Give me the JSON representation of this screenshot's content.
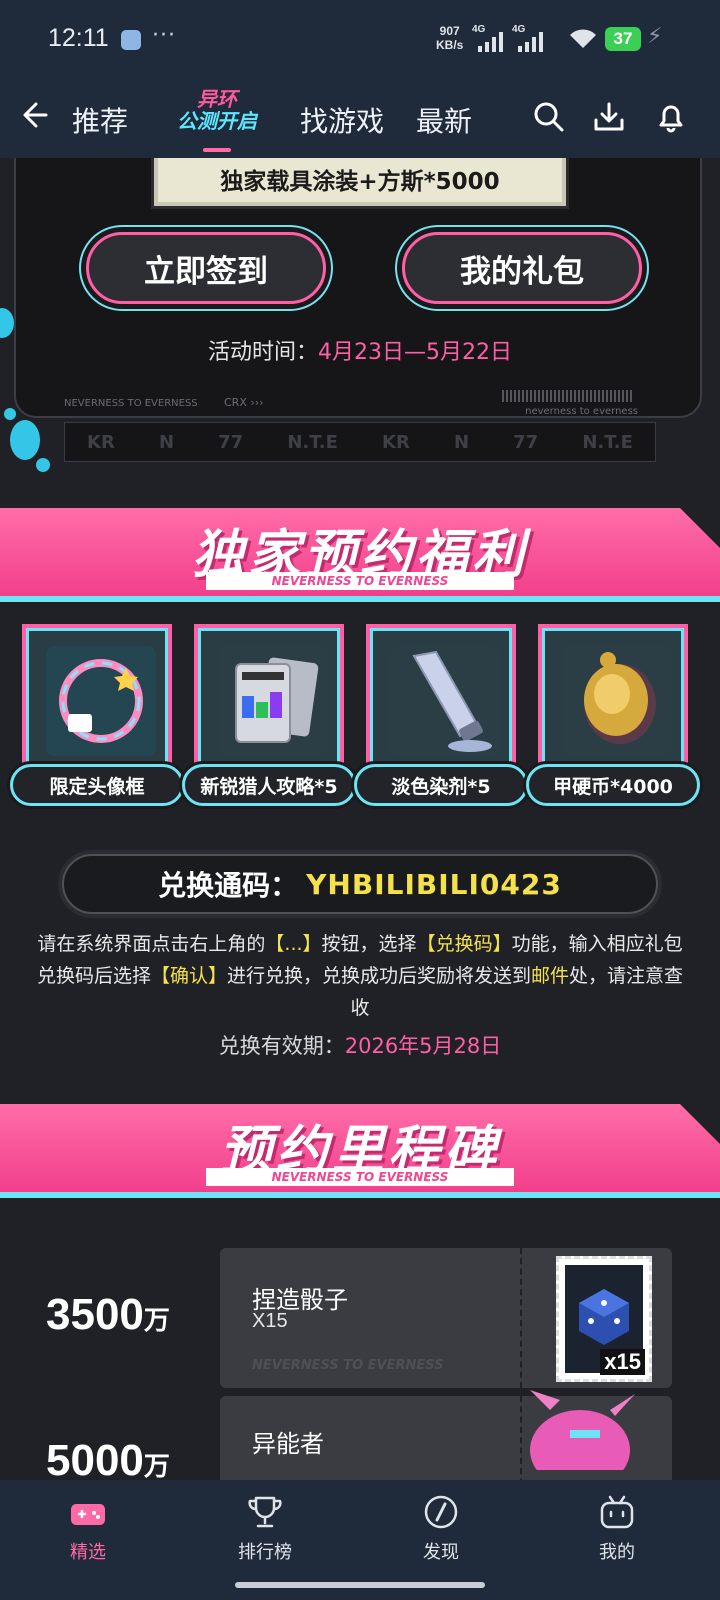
{
  "status_bar": {
    "time": "12:11",
    "more": "···",
    "net_speed_value": "907",
    "net_speed_unit": "KB/s",
    "signal1": "4G",
    "signal2": "4G",
    "battery": "37"
  },
  "nav": {
    "tabs": [
      "推荐",
      "找游戏",
      "最新"
    ],
    "logo_line1": "异环",
    "logo_line2": "公测开启",
    "icons": [
      "back-arrow-icon",
      "search-icon",
      "download-icon",
      "bell-icon"
    ]
  },
  "checkin_card": {
    "prize_text": "独家载具涂装+方斯*5000",
    "checkin_button": "立即签到",
    "my_gift_button": "我的礼包",
    "activity_label": "活动时间：",
    "activity_value": "4月23日—5月22日",
    "footer_left": "NEVERNESS TO EVERNESS",
    "footer_mid": "CRX ›››",
    "footer_right": "neverness to everness"
  },
  "logo_strip": [
    "KR",
    "N",
    "77",
    "N.T.E",
    "KR",
    "N",
    "77",
    "N.T.E"
  ],
  "exclusive": {
    "title": "独家预约福利",
    "subtitle": "NEVERNESS TO EVERNESS",
    "rewards": [
      {
        "label": "限定头像框",
        "icon": "avatar-frame-icon"
      },
      {
        "label": "新锐猎人攻略*5",
        "icon": "guide-book-icon"
      },
      {
        "label": "淡色染剂*5",
        "icon": "dye-tube-icon"
      },
      {
        "label": "甲硬币*4000",
        "icon": "gold-coin-icon"
      }
    ],
    "code_label": "兑换通码：",
    "code_value": "YHBILIBILI0423",
    "instr_1": "请在系统界面点击右上角的",
    "instr_hl1": "【...】",
    "instr_2": "按钮，选择",
    "instr_hl2": "【兑换码】",
    "instr_3": "功能，输入相应礼包兑换码后选择",
    "instr_hl3": "【确认】",
    "instr_4": "进行兑换，兑换成功后奖励将发送到",
    "instr_hl4": "邮件",
    "instr_5": "处，请注意查收",
    "validity_label": "兑换有效期：",
    "validity_value": "2026年5月28日"
  },
  "milestones": {
    "title": "预约里程碑",
    "subtitle": "NEVERNESS TO EVERNESS",
    "items": [
      {
        "value": "3500",
        "unit": "万",
        "name": "捏造骰子",
        "qty": "X15",
        "watermark": "NEVERNESS TO EVERNESS",
        "stamp_qty": "x15",
        "icon": "dice-icon"
      },
      {
        "value": "5000",
        "unit": "万",
        "name": "异能者",
        "qty": "",
        "watermark": "",
        "stamp_qty": "",
        "icon": "character-icon"
      }
    ]
  },
  "tabbar": {
    "items": [
      {
        "label": "精选",
        "icon": "gamepad-icon",
        "active": true
      },
      {
        "label": "排行榜",
        "icon": "trophy-icon",
        "active": false
      },
      {
        "label": "发现",
        "icon": "compass-icon",
        "active": false
      },
      {
        "label": "我的",
        "icon": "tv-mascot-icon",
        "active": false
      }
    ]
  },
  "colors": {
    "accent_pink": "#ff5fa4",
    "accent_cyan": "#6ee3f3",
    "highlight_yellow": "#f5e14b",
    "bar_bg": "#1f2a3b"
  }
}
